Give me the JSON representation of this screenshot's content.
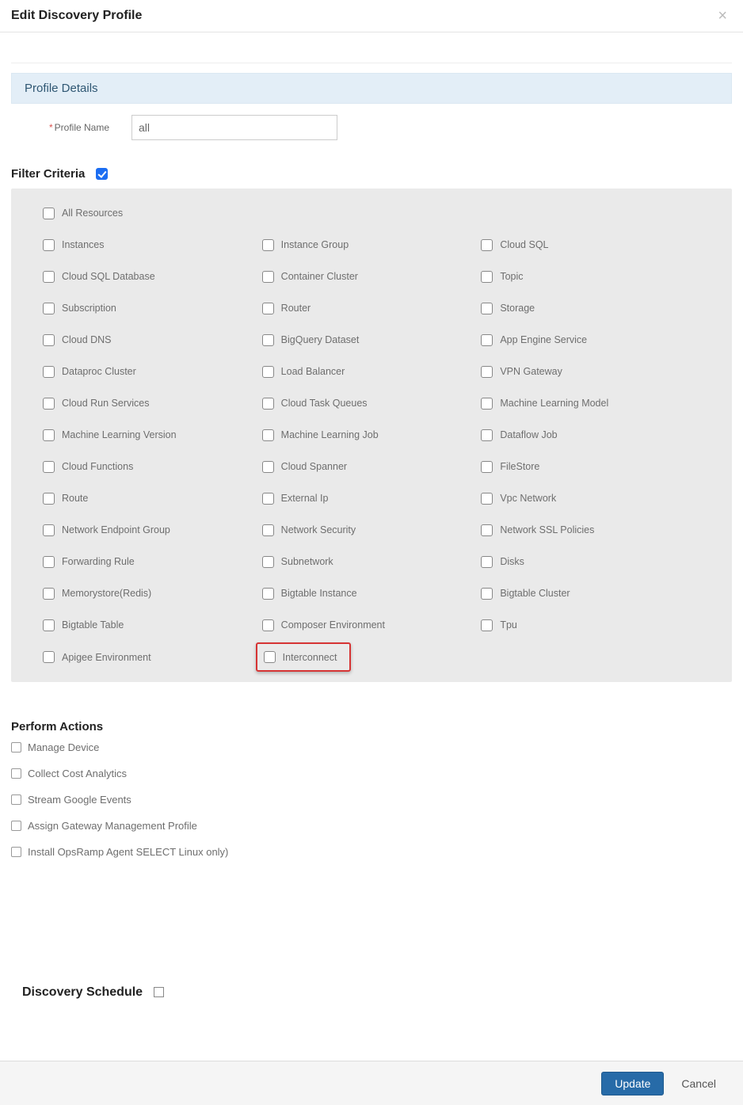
{
  "dialog": {
    "title": "Edit Discovery Profile",
    "close_icon": "×"
  },
  "panel": {
    "header": "Profile Details"
  },
  "profile": {
    "name_label": "Profile Name",
    "name_value": "all"
  },
  "filter": {
    "section_title": "Filter Criteria",
    "master_checked": true,
    "items": [
      "All Resources",
      "Instances",
      "Instance Group",
      "Cloud SQL",
      "Cloud SQL Database",
      "Container Cluster",
      "Topic",
      "Subscription",
      "Router",
      "Storage",
      "Cloud DNS",
      "BigQuery Dataset",
      "App Engine Service",
      "Dataproc Cluster",
      "Load Balancer",
      "VPN Gateway",
      "Cloud Run Services",
      "Cloud Task Queues",
      "Machine Learning Model",
      "Machine Learning Version",
      "Machine Learning Job",
      "Dataflow Job",
      "Cloud Functions",
      "Cloud Spanner",
      "FileStore",
      "Route",
      "External Ip",
      "Vpc Network",
      "Network Endpoint Group",
      "Network Security",
      "Network SSL Policies",
      "Forwarding Rule",
      "Subnetwork",
      "Disks",
      "Memorystore(Redis)",
      "Bigtable Instance",
      "Bigtable Cluster",
      "Bigtable Table",
      "Composer Environment",
      "Tpu",
      "Apigee Environment",
      "Interconnect"
    ],
    "highlighted_index": 41
  },
  "actions": {
    "section_title": "Perform Actions",
    "items": [
      "Manage Device",
      "Collect Cost Analytics",
      "Stream Google Events",
      "Assign Gateway Management Profile",
      "Install OpsRamp Agent SELECT Linux only)"
    ]
  },
  "schedule": {
    "label": "Discovery Schedule",
    "checked": false
  },
  "footer": {
    "update_label": "Update",
    "cancel_label": "Cancel"
  }
}
